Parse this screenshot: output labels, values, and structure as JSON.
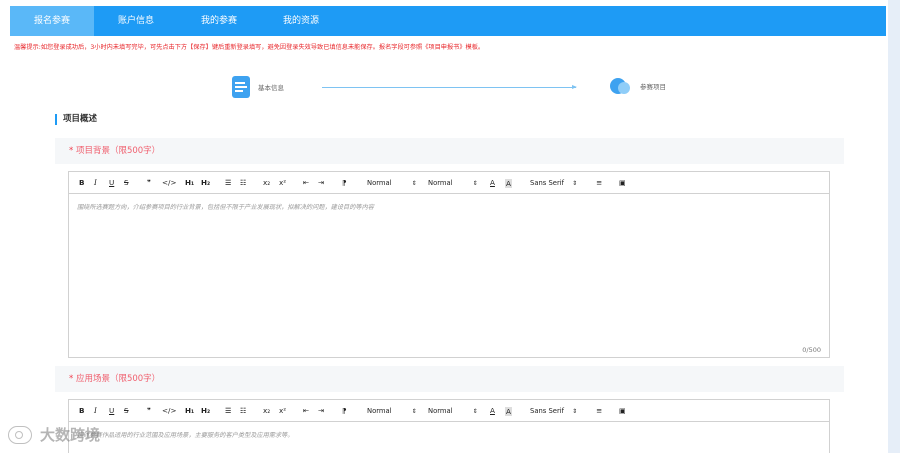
{
  "nav": {
    "tabs": [
      {
        "label": "报名参赛",
        "active": true
      },
      {
        "label": "账户信息",
        "active": false
      },
      {
        "label": "我的参赛",
        "active": false
      },
      {
        "label": "我的资源",
        "active": false
      }
    ]
  },
  "warning": "温馨提示:如您登录成功后，3小时内未填写完毕，可先点击下方【保存】键后重新登录填写，避免因登录失效导致已填信息未能保存。报名字段可参照《项目申报书》模板。",
  "steps": [
    {
      "label": "基本信息"
    },
    {
      "label": "参赛项目"
    }
  ],
  "section_title": "项目概述",
  "toolbar": {
    "bold": "B",
    "italic": "I",
    "underline": "U",
    "strike": "S",
    "quote": "❞",
    "code": "</>",
    "h1": "H₁",
    "h2": "H₂",
    "ordered_list": "☰",
    "bullet_list": "☷",
    "sub": "x₂",
    "sup": "x²",
    "outdent": "⇤",
    "indent": "⇥",
    "rtl": "⁋",
    "size_select": "Normal",
    "header_select": "Normal",
    "color": "A",
    "background": "A",
    "font_select": "Sans Serif",
    "align": "≡",
    "image": "▣"
  },
  "fields": [
    {
      "star": "*",
      "label": "项目背景（限500字）",
      "placeholder": "围绕所选赛题方向，介绍参赛项目的行业背景，包括但不限于产业发展现状，拟解决的问题，建设目的等内容",
      "counter": "0/500"
    },
    {
      "star": "*",
      "label": "应用场景（限500字）",
      "placeholder": "描述参赛作品适用的行业范围及应用场景，主要服务的客户类型及应用需求等。",
      "counter": ""
    }
  ],
  "watermark": "大数跨境",
  "colors": {
    "nav_bg": "#1e9bf5",
    "nav_active": "#5ab8f8",
    "warning": "#e8262a",
    "required": "#f0606f"
  }
}
